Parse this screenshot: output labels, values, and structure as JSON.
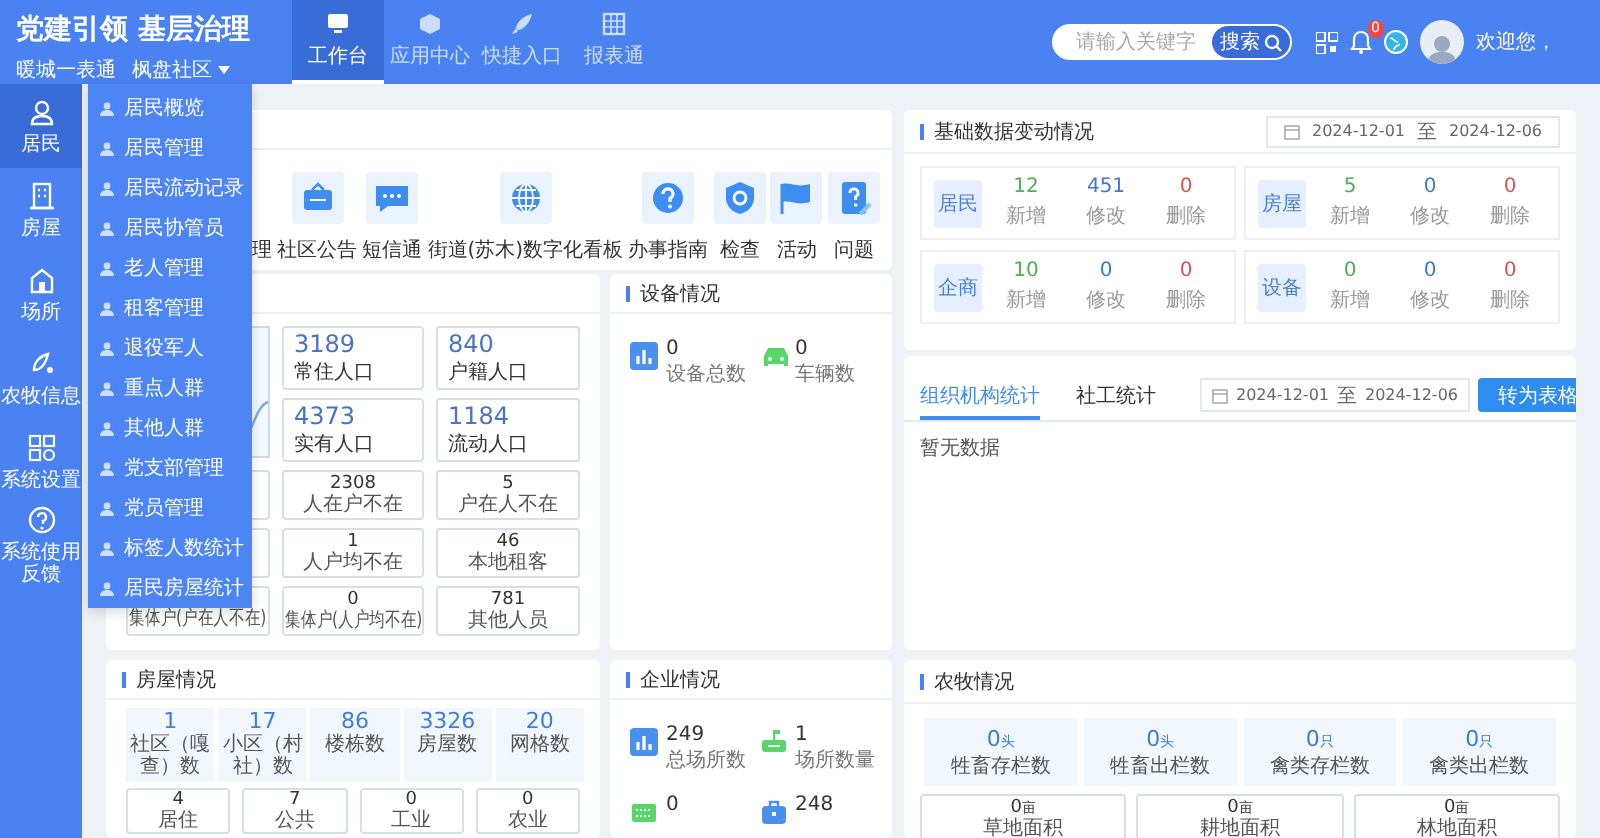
{
  "header": {
    "title": "党建引领 基层治理",
    "region": "暖城一表通",
    "community": "枫盘社区",
    "nav": [
      {
        "label": "工作台",
        "selected": true
      },
      {
        "label": "应用中心",
        "selected": false
      },
      {
        "label": "快捷入口",
        "selected": false
      },
      {
        "label": "报表通",
        "selected": false
      }
    ],
    "search": {
      "placeholder": "请输入关键字",
      "button": "搜索"
    },
    "notification_count": "0",
    "greeting": "欢迎您，"
  },
  "sidebar": {
    "items": [
      {
        "label": "居民",
        "selected": true
      },
      {
        "label": "房屋",
        "selected": false
      },
      {
        "label": "场所",
        "selected": false
      },
      {
        "label": "农牧信息",
        "selected": false
      },
      {
        "label": "系统设置",
        "selected": false
      },
      {
        "label": "系统使用反馈",
        "selected": false
      }
    ]
  },
  "submenu": {
    "items": [
      "居民概览",
      "居民管理",
      "居民流动记录",
      "居民协管员",
      "老人管理",
      "租客管理",
      "退役军人",
      "重点人群",
      "其他人群",
      "党支部管理",
      "党员管理",
      "标签人数统计",
      "居民房屋统计"
    ]
  },
  "shortcuts": {
    "items": [
      "理",
      "社区公告",
      "短信通",
      "街道(苏木)数字化看板",
      "办事指南",
      "检查",
      "活动",
      "问题"
    ]
  },
  "basic_data": {
    "title": "基础数据变动情况",
    "date_from": "2024-12-01",
    "date_sep": "至",
    "date_to": "2024-12-06",
    "groups": [
      {
        "name": "居民",
        "stats": [
          {
            "kind": "added",
            "value": "12",
            "label": "新增"
          },
          {
            "kind": "modified",
            "value": "451",
            "label": "修改"
          },
          {
            "kind": "deleted",
            "value": "0",
            "label": "删除"
          }
        ]
      },
      {
        "name": "房屋",
        "stats": [
          {
            "kind": "added",
            "value": "5",
            "label": "新增"
          },
          {
            "kind": "modified",
            "value": "0",
            "label": "修改"
          },
          {
            "kind": "deleted",
            "value": "0",
            "label": "删除"
          }
        ]
      },
      {
        "name": "企商",
        "stats": [
          {
            "kind": "added",
            "value": "10",
            "label": "新增"
          },
          {
            "kind": "modified",
            "value": "0",
            "label": "修改"
          },
          {
            "kind": "deleted",
            "value": "0",
            "label": "删除"
          }
        ]
      },
      {
        "name": "设备",
        "stats": [
          {
            "kind": "added",
            "value": "0",
            "label": "新增"
          },
          {
            "kind": "modified",
            "value": "0",
            "label": "修改"
          },
          {
            "kind": "deleted",
            "value": "0",
            "label": "删除"
          }
        ]
      }
    ]
  },
  "population": {
    "large_cards": [
      {
        "value": "3189",
        "label": "常住人口"
      },
      {
        "value": "840",
        "label": "户籍人口"
      },
      {
        "value": "4373",
        "label": "实有人口"
      },
      {
        "value": "1184",
        "label": "流动人口"
      }
    ],
    "small_cards": [
      {
        "value": "2308",
        "label": "人在户不在"
      },
      {
        "value": "5",
        "label": "户在人不在"
      },
      {
        "value": "1",
        "label": "人户均不在"
      },
      {
        "value": "46",
        "label": "本地租客"
      },
      {
        "label": "集体户(户在人不在)"
      },
      {
        "value": "0",
        "label": "集体户(人户均不在)"
      },
      {
        "value": "781",
        "label": "其他人员"
      }
    ]
  },
  "devices": {
    "title": "设备情况",
    "items": [
      {
        "value": "0",
        "label": "设备总数"
      },
      {
        "value": "0",
        "label": "车辆数"
      }
    ]
  },
  "org_stats": {
    "tabs": [
      {
        "label": "组织机构统计",
        "selected": true
      },
      {
        "label": "社工统计",
        "selected": false
      }
    ],
    "date_from": "2024-12-01",
    "date_sep": "至",
    "date_to": "2024-12-06",
    "button": "转为表格",
    "empty_text": "暂无数据"
  },
  "housing": {
    "title": "房屋情况",
    "stats": [
      {
        "value": "1",
        "label": "社区（嘎查）数"
      },
      {
        "value": "17",
        "label": "小区（村社）数"
      },
      {
        "value": "86",
        "label": "楼栋数"
      },
      {
        "value": "3326",
        "label": "房屋数"
      },
      {
        "value": "20",
        "label": "网格数"
      }
    ],
    "types": [
      {
        "value": "4",
        "label": "居住"
      },
      {
        "value": "7",
        "label": "公共"
      },
      {
        "value": "0",
        "label": "工业"
      },
      {
        "value": "0",
        "label": "农业"
      }
    ]
  },
  "enterprise": {
    "title": "企业情况",
    "items": [
      {
        "value": "249",
        "label": "总场所数"
      },
      {
        "value": "1",
        "label": "场所数量"
      },
      {
        "value": "0"
      },
      {
        "value": "248"
      }
    ]
  },
  "agriculture": {
    "title": "农牧情况",
    "livestock": [
      {
        "value": "0",
        "unit": "头",
        "label": "牲畜存栏数"
      },
      {
        "value": "0",
        "unit": "头",
        "label": "牲畜出栏数"
      },
      {
        "value": "0",
        "unit": "只",
        "label": "禽类存栏数"
      },
      {
        "value": "0",
        "unit": "只",
        "label": "禽类出栏数"
      }
    ],
    "land": [
      {
        "value": "0",
        "unit": "亩",
        "label": "草地面积"
      },
      {
        "value": "0",
        "unit": "亩",
        "label": "耕地面积"
      },
      {
        "value": "0",
        "unit": "亩",
        "label": "林地面积"
      }
    ]
  }
}
